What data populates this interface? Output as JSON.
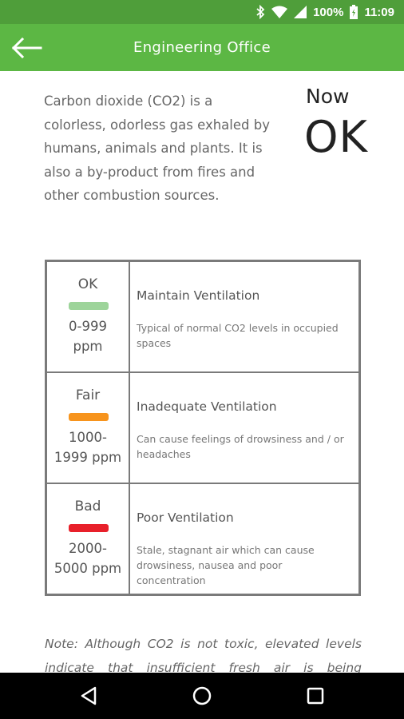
{
  "status_bar": {
    "battery": "100%",
    "time": "11:09",
    "icons": [
      "bluetooth-icon",
      "wifi-icon",
      "cell-signal-icon",
      "battery-icon"
    ]
  },
  "app_bar": {
    "title": "Engineering Office",
    "back_icon": "arrow-left-icon",
    "color": "#5cb744"
  },
  "intro": {
    "text": "Carbon dioxide (CO2) is a colorless, odorless gas exhaled by humans, animals and plants. It is also a by-product from fires and other combustion sources."
  },
  "now": {
    "label": "Now",
    "value": "OK"
  },
  "levels": [
    {
      "name": "OK",
      "color": "#9dd49a",
      "range_line1": "0-999",
      "range_line2": "ppm",
      "ventilation": "Maintain Ventilation",
      "description": "Typical of normal CO2 levels in occupied spaces"
    },
    {
      "name": "Fair",
      "color": "#f7941d",
      "range_line1": "1000-",
      "range_line2": "1999 ppm",
      "ventilation": "Inadequate Ventilation",
      "description": "Can cause feelings of drowsiness and / or headaches"
    },
    {
      "name": "Bad",
      "color": "#e8202a",
      "range_line1": "2000-",
      "range_line2": "5000 ppm",
      "ventilation": "Poor Ventilation",
      "description": "Stale, stagnant air which can cause drowsiness, nausea and poor concentration"
    }
  ],
  "note": {
    "text": "Note: Although CO2 is not toxic, elevated levels indicate that insufficient fresh air is being"
  },
  "nav_bar": {
    "icons": [
      "back-triangle-icon",
      "home-circle-icon",
      "recents-square-icon"
    ]
  }
}
